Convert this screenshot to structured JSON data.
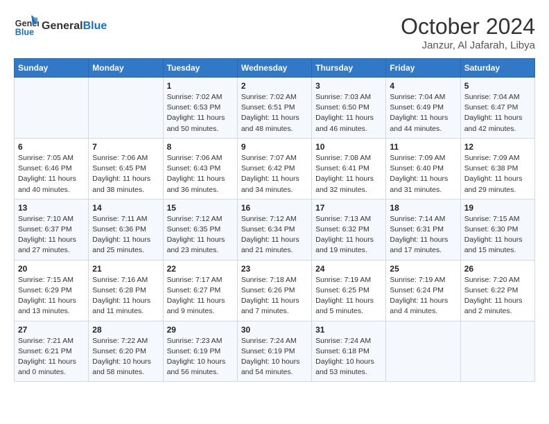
{
  "header": {
    "logo_line1": "General",
    "logo_line2": "Blue",
    "month": "October 2024",
    "location": "Janzur, Al Jafarah, Libya"
  },
  "weekdays": [
    "Sunday",
    "Monday",
    "Tuesday",
    "Wednesday",
    "Thursday",
    "Friday",
    "Saturday"
  ],
  "weeks": [
    [
      {
        "day": "",
        "info": ""
      },
      {
        "day": "",
        "info": ""
      },
      {
        "day": "1",
        "info": "Sunrise: 7:02 AM\nSunset: 6:53 PM\nDaylight: 11 hours and 50 minutes."
      },
      {
        "day": "2",
        "info": "Sunrise: 7:02 AM\nSunset: 6:51 PM\nDaylight: 11 hours and 48 minutes."
      },
      {
        "day": "3",
        "info": "Sunrise: 7:03 AM\nSunset: 6:50 PM\nDaylight: 11 hours and 46 minutes."
      },
      {
        "day": "4",
        "info": "Sunrise: 7:04 AM\nSunset: 6:49 PM\nDaylight: 11 hours and 44 minutes."
      },
      {
        "day": "5",
        "info": "Sunrise: 7:04 AM\nSunset: 6:47 PM\nDaylight: 11 hours and 42 minutes."
      }
    ],
    [
      {
        "day": "6",
        "info": "Sunrise: 7:05 AM\nSunset: 6:46 PM\nDaylight: 11 hours and 40 minutes."
      },
      {
        "day": "7",
        "info": "Sunrise: 7:06 AM\nSunset: 6:45 PM\nDaylight: 11 hours and 38 minutes."
      },
      {
        "day": "8",
        "info": "Sunrise: 7:06 AM\nSunset: 6:43 PM\nDaylight: 11 hours and 36 minutes."
      },
      {
        "day": "9",
        "info": "Sunrise: 7:07 AM\nSunset: 6:42 PM\nDaylight: 11 hours and 34 minutes."
      },
      {
        "day": "10",
        "info": "Sunrise: 7:08 AM\nSunset: 6:41 PM\nDaylight: 11 hours and 32 minutes."
      },
      {
        "day": "11",
        "info": "Sunrise: 7:09 AM\nSunset: 6:40 PM\nDaylight: 11 hours and 31 minutes."
      },
      {
        "day": "12",
        "info": "Sunrise: 7:09 AM\nSunset: 6:38 PM\nDaylight: 11 hours and 29 minutes."
      }
    ],
    [
      {
        "day": "13",
        "info": "Sunrise: 7:10 AM\nSunset: 6:37 PM\nDaylight: 11 hours and 27 minutes."
      },
      {
        "day": "14",
        "info": "Sunrise: 7:11 AM\nSunset: 6:36 PM\nDaylight: 11 hours and 25 minutes."
      },
      {
        "day": "15",
        "info": "Sunrise: 7:12 AM\nSunset: 6:35 PM\nDaylight: 11 hours and 23 minutes."
      },
      {
        "day": "16",
        "info": "Sunrise: 7:12 AM\nSunset: 6:34 PM\nDaylight: 11 hours and 21 minutes."
      },
      {
        "day": "17",
        "info": "Sunrise: 7:13 AM\nSunset: 6:32 PM\nDaylight: 11 hours and 19 minutes."
      },
      {
        "day": "18",
        "info": "Sunrise: 7:14 AM\nSunset: 6:31 PM\nDaylight: 11 hours and 17 minutes."
      },
      {
        "day": "19",
        "info": "Sunrise: 7:15 AM\nSunset: 6:30 PM\nDaylight: 11 hours and 15 minutes."
      }
    ],
    [
      {
        "day": "20",
        "info": "Sunrise: 7:15 AM\nSunset: 6:29 PM\nDaylight: 11 hours and 13 minutes."
      },
      {
        "day": "21",
        "info": "Sunrise: 7:16 AM\nSunset: 6:28 PM\nDaylight: 11 hours and 11 minutes."
      },
      {
        "day": "22",
        "info": "Sunrise: 7:17 AM\nSunset: 6:27 PM\nDaylight: 11 hours and 9 minutes."
      },
      {
        "day": "23",
        "info": "Sunrise: 7:18 AM\nSunset: 6:26 PM\nDaylight: 11 hours and 7 minutes."
      },
      {
        "day": "24",
        "info": "Sunrise: 7:19 AM\nSunset: 6:25 PM\nDaylight: 11 hours and 5 minutes."
      },
      {
        "day": "25",
        "info": "Sunrise: 7:19 AM\nSunset: 6:24 PM\nDaylight: 11 hours and 4 minutes."
      },
      {
        "day": "26",
        "info": "Sunrise: 7:20 AM\nSunset: 6:22 PM\nDaylight: 11 hours and 2 minutes."
      }
    ],
    [
      {
        "day": "27",
        "info": "Sunrise: 7:21 AM\nSunset: 6:21 PM\nDaylight: 11 hours and 0 minutes."
      },
      {
        "day": "28",
        "info": "Sunrise: 7:22 AM\nSunset: 6:20 PM\nDaylight: 10 hours and 58 minutes."
      },
      {
        "day": "29",
        "info": "Sunrise: 7:23 AM\nSunset: 6:19 PM\nDaylight: 10 hours and 56 minutes."
      },
      {
        "day": "30",
        "info": "Sunrise: 7:24 AM\nSunset: 6:19 PM\nDaylight: 10 hours and 54 minutes."
      },
      {
        "day": "31",
        "info": "Sunrise: 7:24 AM\nSunset: 6:18 PM\nDaylight: 10 hours and 53 minutes."
      },
      {
        "day": "",
        "info": ""
      },
      {
        "day": "",
        "info": ""
      }
    ]
  ]
}
